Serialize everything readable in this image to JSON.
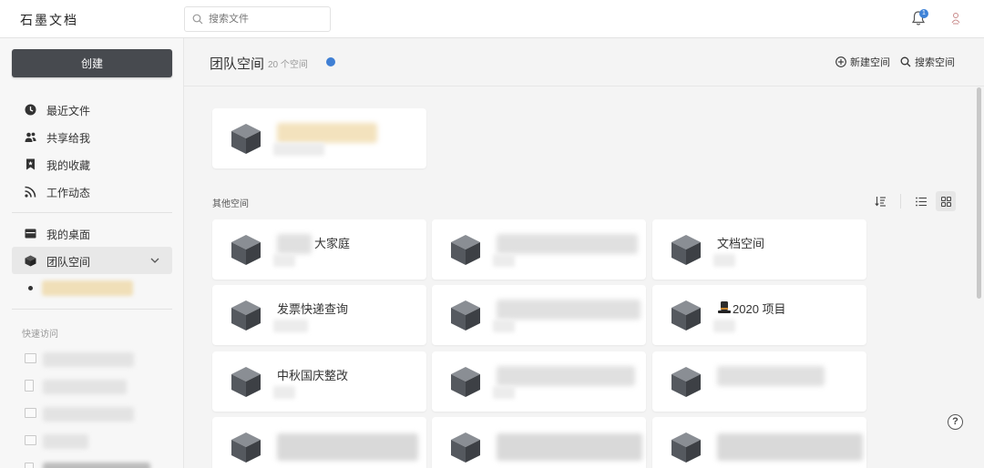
{
  "app": {
    "logo": "石墨文档"
  },
  "search": {
    "placeholder": "搜索文件"
  },
  "notifications": {
    "count": "1"
  },
  "sidebar": {
    "create_label": "创建",
    "items": [
      {
        "label": "最近文件",
        "icon": "clock-icon"
      },
      {
        "label": "共享给我",
        "icon": "users-icon"
      },
      {
        "label": "我的收藏",
        "icon": "bookmark-icon"
      },
      {
        "label": "工作动态",
        "icon": "rss-icon"
      },
      {
        "label": "我的桌面",
        "icon": "desktop-icon"
      },
      {
        "label": "团队空间",
        "icon": "cube-icon"
      }
    ],
    "quick_access_title": "快速访问"
  },
  "main": {
    "title": "团队空间",
    "count": "20 个空间",
    "new_space_label": "新建空间",
    "search_space_label": "搜索空间",
    "other_spaces_title": "其他空间",
    "spaces": [
      {
        "name": "大家庭"
      },
      {
        "name": ""
      },
      {
        "name": "文档空间"
      },
      {
        "name": "发票快递查询"
      },
      {
        "name": ""
      },
      {
        "name": "2020 项目"
      },
      {
        "name": "中秋国庆整改"
      },
      {
        "name": ""
      },
      {
        "name": ""
      },
      {
        "name": ""
      },
      {
        "name": ""
      },
      {
        "name": ""
      }
    ]
  },
  "help_label": "?",
  "colors": {
    "accent": "#3f7fd4",
    "create_button": "#474a4f",
    "cube": "#50545a"
  }
}
